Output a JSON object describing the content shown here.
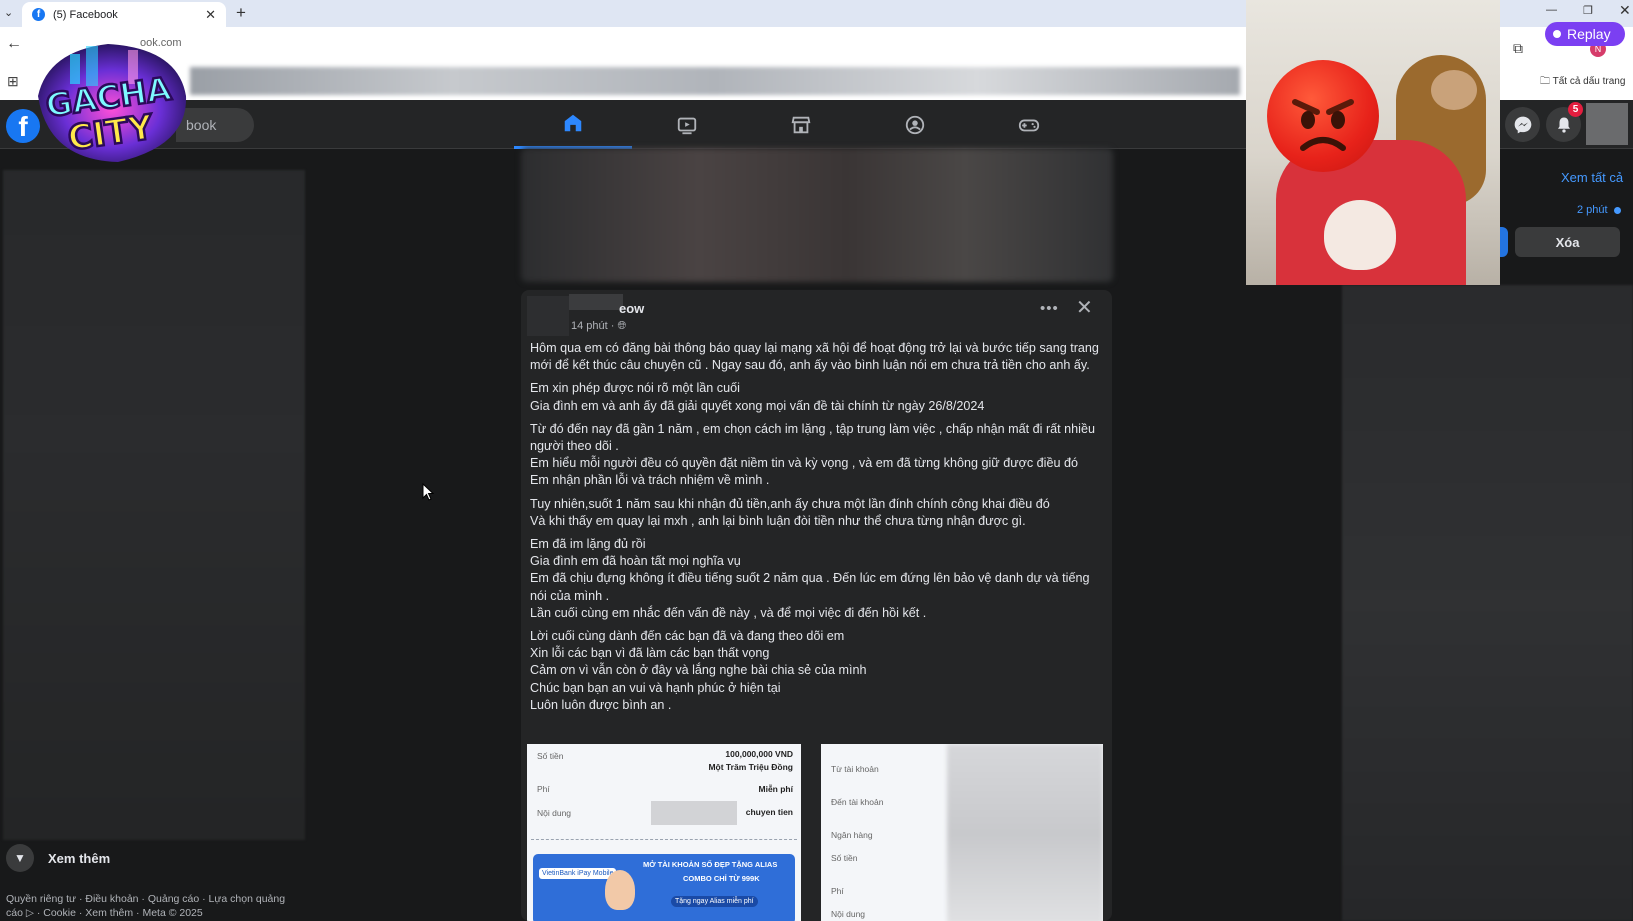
{
  "browser": {
    "tab_title": "(5) Facebook",
    "new_tab": "+",
    "tab_close": "✕",
    "url_partial": "ook.com",
    "bookmarks_all": "Tất cả dấu trang"
  },
  "header": {
    "search_text": "book",
    "notification_count": "5"
  },
  "sidebar": {
    "see_more": "Xem thêm",
    "footer": "Quyền riêng tư · Điều khoản · Quảng cáo · Lựa chọn quảng cáo ▷ · Cookie · Xem thêm · Meta © 2025"
  },
  "post": {
    "author": "eow",
    "time": "14 phút ·",
    "paragraphs": [
      "Hôm qua em có đăng bài thông báo quay lại mạng xã hội để hoạt động trở lại và bước tiếp sang trang mới để kết thúc câu chuyện cũ . Ngay sau đó, anh ấy vào bình luận nói em chưa trả tiền cho anh ấy.",
      "Em xin phép được nói rõ một lần cuối\nGia đình em và anh ấy đã giải quyết xong mọi vấn đề tài chính từ ngày 26/8/2024",
      "Từ đó đến nay đã gần 1 năm , em chọn cách im lặng , tập trung làm việc , chấp nhận mất đi rất nhiều người theo dõi .\nEm hiểu mỗi người đều có quyền đặt niềm tin và kỳ vọng , và em đã từng không giữ được điều đó\nEm nhận phần lỗi và trách nhiệm về mình .",
      "Tuy nhiên,suốt 1 năm sau khi nhận đủ tiền,anh ấy chưa một lần đính chính công khai điều đó\nVà khi thấy em quay lại mxh , anh lại bình luận đòi tiền như thể chưa từng nhận được gì.",
      "Em đã im lặng đủ rồi\nGia đình em đã hoàn tất mọi nghĩa vụ\nEm đã chịu đựng không ít điều tiếng suốt 2 năm qua . Đến lúc em đứng lên bảo vệ danh dự và tiếng nói của mình .\nLần cuối cùng em nhắc đến vấn đề này , và để mọi việc đi đến hồi kết .",
      "Lời cuối cùng dành đến các bạn đã và đang theo dõi em\nXin lỗi các bạn vì đã làm các bạn thất vọng\nCảm ơn vì vẫn còn ở đây và lắng nghe bài chia sẻ của mình\nChúc bạn bạn an vui và hạnh phúc ở hiện tại\nLuôn luôn được bình an ."
    ],
    "receipt1": {
      "amount_label": "Số tiền",
      "amount_value": "100,000,000 VND",
      "amount_words": "Một Trăm Triệu Đồng",
      "fee_label": "Phí",
      "fee_value": "Miễn phí",
      "content_label": "Nội dung",
      "content_value": "chuyen tien",
      "banner_line1": "MỞ TÀI KHOẢN SỐ ĐẸP TẶNG ALIAS",
      "banner_line2": "COMBO CHỈ TỪ 999K",
      "banner_line3": "Tặng ngay Alias miễn phí",
      "bank_name": "VietinBank iPay Mobile"
    },
    "receipt2": {
      "from_label": "Từ tài khoản",
      "to_label": "Đến tài khoản",
      "bank_label": "Ngân hàng",
      "amount_label": "Số tiền",
      "fee_label": "Phí",
      "content_label": "Nội dung"
    }
  },
  "right_panel": {
    "see_all": "Xem tất cả",
    "notif_time": "2 phút",
    "delete_label": "Xóa"
  },
  "overlay": {
    "replay_label": "Replay",
    "logo_text": "GACHA CITY",
    "profile_initial": "N"
  },
  "colors": {
    "fb_blue": "#1877f2",
    "link_blue": "#4599ff",
    "badge_red": "#e41e3f",
    "replay_purple": "#7b3ff2"
  }
}
